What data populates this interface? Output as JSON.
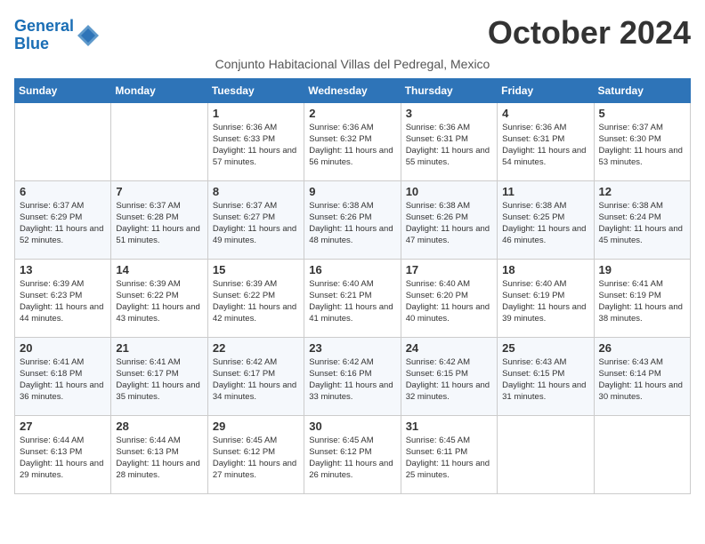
{
  "logo": {
    "line1": "General",
    "line2": "Blue"
  },
  "title": "October 2024",
  "subtitle": "Conjunto Habitacional Villas del Pedregal, Mexico",
  "weekdays": [
    "Sunday",
    "Monday",
    "Tuesday",
    "Wednesday",
    "Thursday",
    "Friday",
    "Saturday"
  ],
  "weeks": [
    [
      {
        "day": "",
        "info": ""
      },
      {
        "day": "",
        "info": ""
      },
      {
        "day": "1",
        "info": "Sunrise: 6:36 AM\nSunset: 6:33 PM\nDaylight: 11 hours and 57 minutes."
      },
      {
        "day": "2",
        "info": "Sunrise: 6:36 AM\nSunset: 6:32 PM\nDaylight: 11 hours and 56 minutes."
      },
      {
        "day": "3",
        "info": "Sunrise: 6:36 AM\nSunset: 6:31 PM\nDaylight: 11 hours and 55 minutes."
      },
      {
        "day": "4",
        "info": "Sunrise: 6:36 AM\nSunset: 6:31 PM\nDaylight: 11 hours and 54 minutes."
      },
      {
        "day": "5",
        "info": "Sunrise: 6:37 AM\nSunset: 6:30 PM\nDaylight: 11 hours and 53 minutes."
      }
    ],
    [
      {
        "day": "6",
        "info": "Sunrise: 6:37 AM\nSunset: 6:29 PM\nDaylight: 11 hours and 52 minutes."
      },
      {
        "day": "7",
        "info": "Sunrise: 6:37 AM\nSunset: 6:28 PM\nDaylight: 11 hours and 51 minutes."
      },
      {
        "day": "8",
        "info": "Sunrise: 6:37 AM\nSunset: 6:27 PM\nDaylight: 11 hours and 49 minutes."
      },
      {
        "day": "9",
        "info": "Sunrise: 6:38 AM\nSunset: 6:26 PM\nDaylight: 11 hours and 48 minutes."
      },
      {
        "day": "10",
        "info": "Sunrise: 6:38 AM\nSunset: 6:26 PM\nDaylight: 11 hours and 47 minutes."
      },
      {
        "day": "11",
        "info": "Sunrise: 6:38 AM\nSunset: 6:25 PM\nDaylight: 11 hours and 46 minutes."
      },
      {
        "day": "12",
        "info": "Sunrise: 6:38 AM\nSunset: 6:24 PM\nDaylight: 11 hours and 45 minutes."
      }
    ],
    [
      {
        "day": "13",
        "info": "Sunrise: 6:39 AM\nSunset: 6:23 PM\nDaylight: 11 hours and 44 minutes."
      },
      {
        "day": "14",
        "info": "Sunrise: 6:39 AM\nSunset: 6:22 PM\nDaylight: 11 hours and 43 minutes."
      },
      {
        "day": "15",
        "info": "Sunrise: 6:39 AM\nSunset: 6:22 PM\nDaylight: 11 hours and 42 minutes."
      },
      {
        "day": "16",
        "info": "Sunrise: 6:40 AM\nSunset: 6:21 PM\nDaylight: 11 hours and 41 minutes."
      },
      {
        "day": "17",
        "info": "Sunrise: 6:40 AM\nSunset: 6:20 PM\nDaylight: 11 hours and 40 minutes."
      },
      {
        "day": "18",
        "info": "Sunrise: 6:40 AM\nSunset: 6:19 PM\nDaylight: 11 hours and 39 minutes."
      },
      {
        "day": "19",
        "info": "Sunrise: 6:41 AM\nSunset: 6:19 PM\nDaylight: 11 hours and 38 minutes."
      }
    ],
    [
      {
        "day": "20",
        "info": "Sunrise: 6:41 AM\nSunset: 6:18 PM\nDaylight: 11 hours and 36 minutes."
      },
      {
        "day": "21",
        "info": "Sunrise: 6:41 AM\nSunset: 6:17 PM\nDaylight: 11 hours and 35 minutes."
      },
      {
        "day": "22",
        "info": "Sunrise: 6:42 AM\nSunset: 6:17 PM\nDaylight: 11 hours and 34 minutes."
      },
      {
        "day": "23",
        "info": "Sunrise: 6:42 AM\nSunset: 6:16 PM\nDaylight: 11 hours and 33 minutes."
      },
      {
        "day": "24",
        "info": "Sunrise: 6:42 AM\nSunset: 6:15 PM\nDaylight: 11 hours and 32 minutes."
      },
      {
        "day": "25",
        "info": "Sunrise: 6:43 AM\nSunset: 6:15 PM\nDaylight: 11 hours and 31 minutes."
      },
      {
        "day": "26",
        "info": "Sunrise: 6:43 AM\nSunset: 6:14 PM\nDaylight: 11 hours and 30 minutes."
      }
    ],
    [
      {
        "day": "27",
        "info": "Sunrise: 6:44 AM\nSunset: 6:13 PM\nDaylight: 11 hours and 29 minutes."
      },
      {
        "day": "28",
        "info": "Sunrise: 6:44 AM\nSunset: 6:13 PM\nDaylight: 11 hours and 28 minutes."
      },
      {
        "day": "29",
        "info": "Sunrise: 6:45 AM\nSunset: 6:12 PM\nDaylight: 11 hours and 27 minutes."
      },
      {
        "day": "30",
        "info": "Sunrise: 6:45 AM\nSunset: 6:12 PM\nDaylight: 11 hours and 26 minutes."
      },
      {
        "day": "31",
        "info": "Sunrise: 6:45 AM\nSunset: 6:11 PM\nDaylight: 11 hours and 25 minutes."
      },
      {
        "day": "",
        "info": ""
      },
      {
        "day": "",
        "info": ""
      }
    ]
  ]
}
